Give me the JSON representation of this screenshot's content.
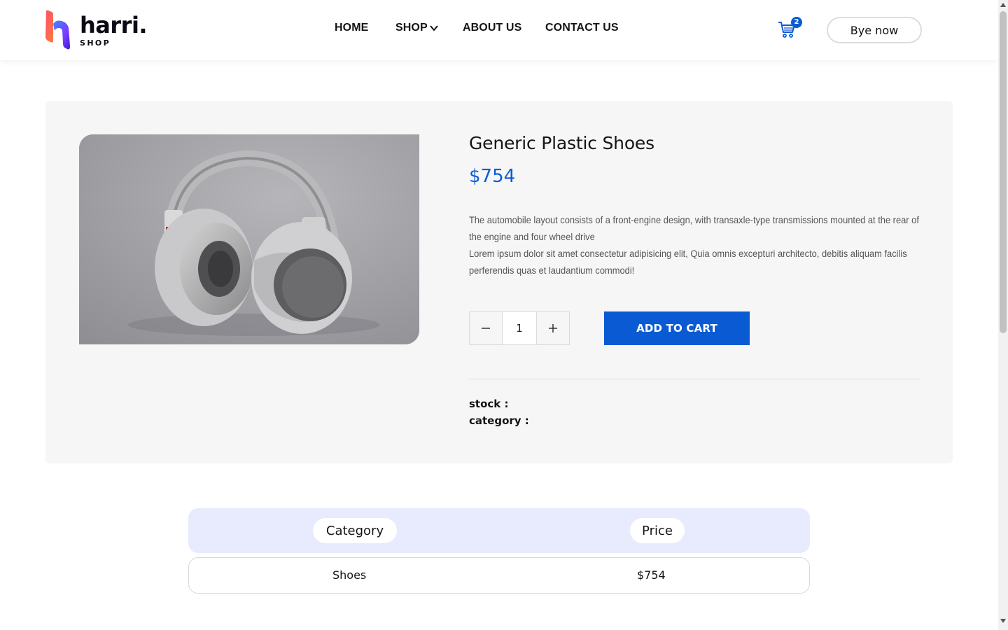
{
  "header": {
    "logo": {
      "word": "harri.",
      "sub": "SHOP"
    },
    "nav": [
      {
        "label": "HOME"
      },
      {
        "label": "SHOP"
      },
      {
        "label": "ABOUT US"
      },
      {
        "label": "CONTACT US"
      }
    ],
    "cart": {
      "count": "2",
      "icon": "cart-icon"
    },
    "cta_label": "Bye now"
  },
  "product": {
    "title": "Generic Plastic Shoes",
    "price": "$754",
    "description_line1": "The automobile layout consists of a front-engine design, with transaxle-type transmissions mounted at the rear of the engine and four wheel drive",
    "description_line2": "Lorem ipsum dolor sit amet consectetur adipisicing elit, Quia omnis excepturi architecto, debitis aliquam facilis perferendis quas et laudantium commodi!",
    "quantity": "1",
    "add_to_cart_label": "ADD TO CART",
    "stock_label": "stock :",
    "category_label": "category :",
    "image_alt": "headphones-image"
  },
  "table": {
    "headers": [
      "Category",
      "Price"
    ],
    "rows": [
      {
        "category": "Shoes",
        "price": "$754"
      }
    ]
  },
  "colors": {
    "accent": "#0a5bd3",
    "table_head_bg": "#e8ebfd",
    "panel_bg": "#f6f6f6"
  }
}
